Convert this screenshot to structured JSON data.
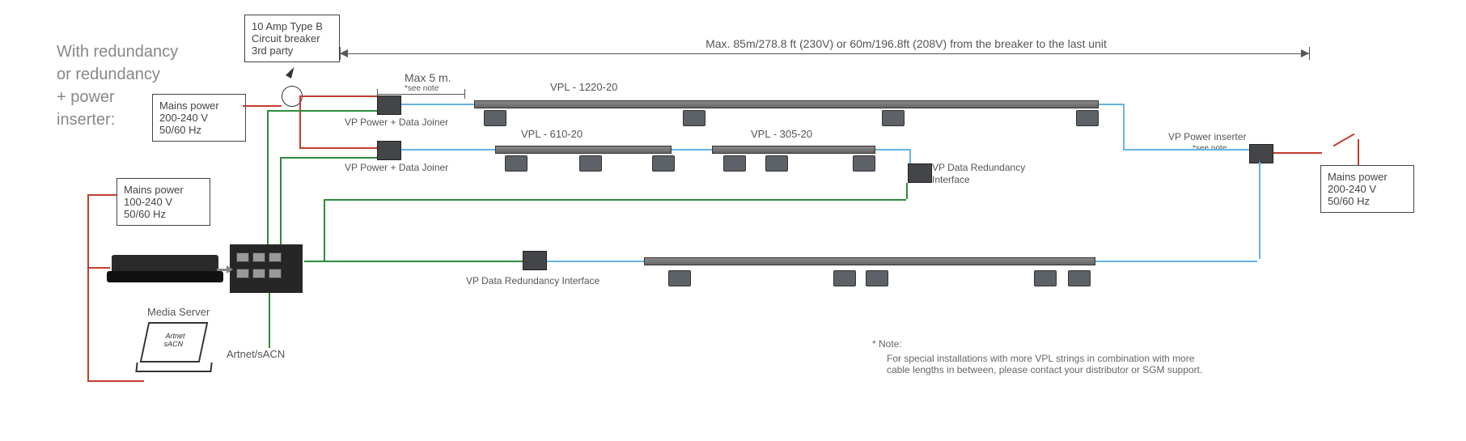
{
  "title_l1": "With redundancy",
  "title_l2": "or redundancy",
  "title_l3": "+ power",
  "title_l4": "inserter:",
  "mains_left": "Mains power\n100-240 V\n50/60 Hz",
  "mains_up": "Mains power\n200-240 V\n50/60 Hz",
  "mains_right": "Mains power\n200-240 V\n50/60 Hz",
  "breaker": "10 Amp Type B\nCircuit breaker\n3rd party",
  "max5": "Max 5 m.",
  "see_note": "*see note",
  "joiner1": "VP Power + Data Joiner",
  "joiner2": "VP Power + Data Joiner",
  "vpl_top": "VPL - 1220-20",
  "vpl_mid_a": "VPL - 610-20",
  "vpl_mid_b": "VPL - 305-20",
  "redund_label": "VP Data Redundancy\nInterface",
  "redund_label2": "VP Data Redundancy Interface",
  "inserter_label": "VP Power inserter",
  "span_label": "Max. 85m/278.8 ft (230V) or 60m/196.8ft (208V) from the breaker to the last unit",
  "media_server": "Media Server",
  "artnet": "Artnet/sACN",
  "laptop_text": "Artnet\nsACN",
  "note_star": "* Note:",
  "note_body": "For special installations with more VPL strings in combination with more\ncable lengths in between, please contact your distributor or SGM support."
}
